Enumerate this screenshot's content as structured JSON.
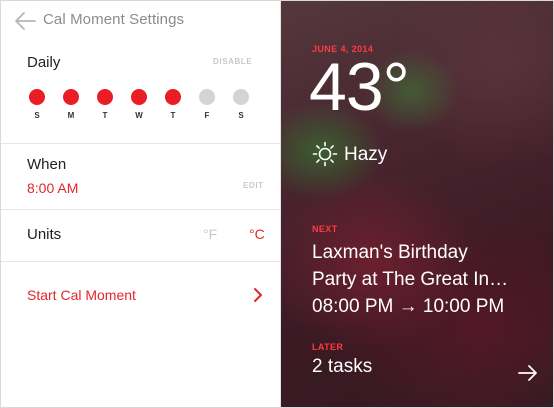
{
  "settings": {
    "title": "Cal Moment Settings",
    "daily": {
      "label": "Daily",
      "action": "DISABLE",
      "days": [
        {
          "letter": "S",
          "active": true
        },
        {
          "letter": "M",
          "active": true
        },
        {
          "letter": "T",
          "active": true
        },
        {
          "letter": "W",
          "active": true
        },
        {
          "letter": "T",
          "active": true
        },
        {
          "letter": "F",
          "active": false
        },
        {
          "letter": "S",
          "active": false
        }
      ]
    },
    "when": {
      "label": "When",
      "value": "8:00 AM",
      "action": "EDIT"
    },
    "units": {
      "label": "Units",
      "fahrenheit": "°F",
      "celsius": "°C",
      "selected": "celsius"
    },
    "start_label": "Start Cal Moment"
  },
  "card": {
    "date": "JUNE 4, 2014",
    "temperature": "43°",
    "condition": "Hazy",
    "condition_icon": "sun-icon",
    "next_label": "NEXT",
    "event_title_line1": "Laxman's Birthday",
    "event_title_line2": "Party at The Great In…",
    "event_time": "08:00 PM → 10:00 PM",
    "later_label": "LATER",
    "tasks": "2 tasks"
  },
  "colors": {
    "accent": "#e3262b",
    "inactive": "#d4d4d4",
    "card_kicker": "#ff3a40"
  }
}
